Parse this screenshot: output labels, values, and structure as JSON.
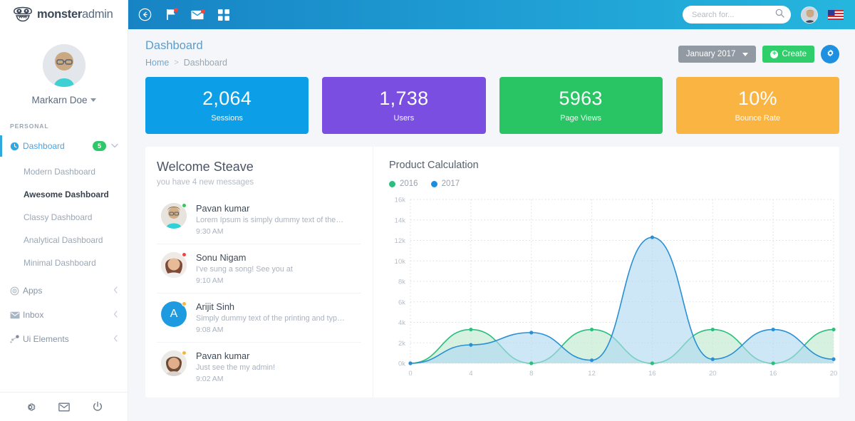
{
  "brand": {
    "name_bold": "monster",
    "name_light": "admin",
    "logo_icon": "monster-face-icon"
  },
  "sidebar": {
    "profile": {
      "name": "Markarn Doe",
      "avatar_icon": "user-avatar"
    },
    "section_label": "PERSONAL",
    "items": [
      {
        "label": "Dashboard",
        "icon": "dashboard-icon",
        "badge": "5",
        "chevron": "chevron-down-icon",
        "active": true
      },
      {
        "label": "Apps",
        "icon": "apps-target-icon",
        "chevron": "chevron-left-icon"
      },
      {
        "label": "Inbox",
        "icon": "envelope-icon",
        "chevron": "chevron-left-icon"
      },
      {
        "label": "Ui Elements",
        "icon": "ui-elements-icon",
        "chevron": "chevron-left-icon"
      }
    ],
    "subitems": [
      {
        "label": "Modern Dashboard"
      },
      {
        "label": "Awesome Dashboard",
        "current": true
      },
      {
        "label": "Classy Dashboard"
      },
      {
        "label": "Analytical Dashboard"
      },
      {
        "label": "Minimal Dashboard"
      }
    ],
    "footer_icons": [
      "gear-icon",
      "envelope-icon",
      "power-icon"
    ]
  },
  "topbar": {
    "icons": [
      "collapse-back-icon",
      "flag-icon",
      "envelope-icon",
      "grid-apps-icon"
    ],
    "search": {
      "placeholder": "Search for...",
      "value": "",
      "icon": "search-icon"
    },
    "avatar_icon": "user-avatar",
    "flag_icon": "us-flag-icon",
    "bg_color": "#1e9ad2"
  },
  "header": {
    "title": "Dashboard",
    "breadcrumb": {
      "home": "Home",
      "separator": ">",
      "current": "Dashboard"
    },
    "date_button": {
      "label": "January 2017",
      "caret": "caret-down-icon",
      "color": "#919aa3"
    },
    "create_button": {
      "label": "Create",
      "icon": "plus-circle-icon",
      "color": "#2fce6b"
    },
    "settings_button": {
      "icon": "gear-icon",
      "color": "#1f8fe0"
    }
  },
  "stats": [
    {
      "value": "2,064",
      "label": "Sessions",
      "color": "#0c9fe8"
    },
    {
      "value": "1,738",
      "label": "Users",
      "color": "#7a4ee0"
    },
    {
      "value": "5963",
      "label": "Page Views",
      "color": "#29c463"
    },
    {
      "value": "10%",
      "label": "Bounce Rate",
      "color": "#fab442"
    }
  ],
  "welcome": {
    "title": "Welcome Steave",
    "subtitle": "you have 4 new messages",
    "messages": [
      {
        "name": "Pavan kumar",
        "text": "Lorem Ipsum is simply dummy text of the pri..",
        "time": "9:30 AM",
        "status_color": "#34c759",
        "avatar_type": "photo",
        "initial": ""
      },
      {
        "name": "Sonu Nigam",
        "text": "I've sung a song! See you at",
        "time": "9:10 AM",
        "status_color": "#f2453d",
        "avatar_type": "photo",
        "initial": ""
      },
      {
        "name": "Arijit Sinh",
        "text": "Simply dummy text of the printing and types..",
        "time": "9:08 AM",
        "status_color": "#f5b53f",
        "avatar_type": "letter",
        "initial": "A"
      },
      {
        "name": "Pavan kumar",
        "text": "Just see the my admin!",
        "time": "9:02 AM",
        "status_color": "#f5b53f",
        "avatar_type": "photo",
        "initial": ""
      }
    ]
  },
  "chart_data": {
    "type": "area",
    "title": "Product Calculation",
    "xlabel": "",
    "ylabel": "",
    "grid": true,
    "legend_position": "top-left",
    "ylim": [
      0,
      16000
    ],
    "ytick_labels": [
      "0k",
      "2k",
      "4k",
      "6k",
      "8k",
      "10k",
      "12k",
      "14k",
      "16k"
    ],
    "ytick_values": [
      0,
      2000,
      4000,
      6000,
      8000,
      10000,
      12000,
      14000,
      16000
    ],
    "xtick_labels": [
      "0",
      "4",
      "8",
      "12",
      "16",
      "20",
      "16",
      "20"
    ],
    "x": [
      0,
      4,
      8,
      12,
      16,
      20,
      24,
      28
    ],
    "series": [
      {
        "name": "2016",
        "color": "#2bbf7e",
        "fill": "#bfe8cf",
        "values": [
          0,
          3300,
          0,
          3300,
          0,
          3300,
          0,
          3300
        ]
      },
      {
        "name": "2017",
        "color": "#2a8fd4",
        "fill": "#aed8f0",
        "values": [
          0,
          1800,
          3000,
          300,
          12300,
          400,
          3300,
          400
        ]
      }
    ]
  }
}
